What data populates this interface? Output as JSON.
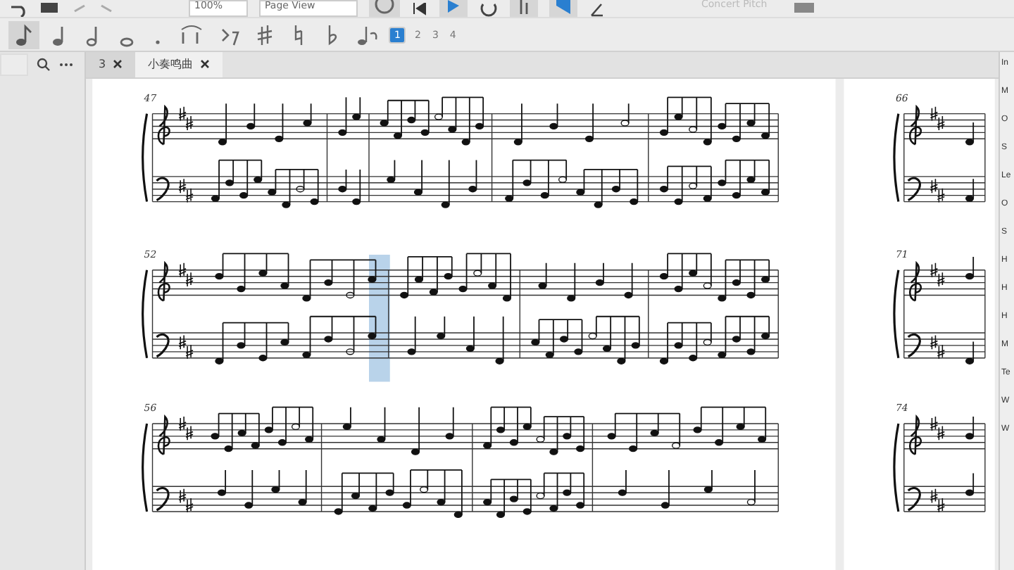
{
  "toolbar": {
    "zoom": "100%",
    "view_mode": "Page View",
    "concert_pitch": "Concert Pitch"
  },
  "note_input": {
    "voices": [
      {
        "label": "1",
        "selected": true
      },
      {
        "label": "2",
        "selected": false
      },
      {
        "label": "3",
        "selected": false
      },
      {
        "label": "4",
        "selected": false
      }
    ]
  },
  "tabs": [
    {
      "label": "3",
      "selected": false
    },
    {
      "label": "小奏鸣曲",
      "selected": true
    }
  ],
  "score": {
    "pages": [
      {
        "systems": [
          {
            "measure_number": "47"
          },
          {
            "measure_number": "52"
          },
          {
            "measure_number": "56"
          }
        ]
      },
      {
        "systems": [
          {
            "measure_number": "66"
          },
          {
            "measure_number": "71"
          },
          {
            "measure_number": "74"
          }
        ]
      }
    ]
  },
  "inspector": {
    "labels": [
      "In",
      "M",
      "O",
      "S",
      "Le",
      "O",
      "S",
      "H",
      "H",
      "H",
      "M",
      "Te",
      "W",
      "W"
    ]
  }
}
